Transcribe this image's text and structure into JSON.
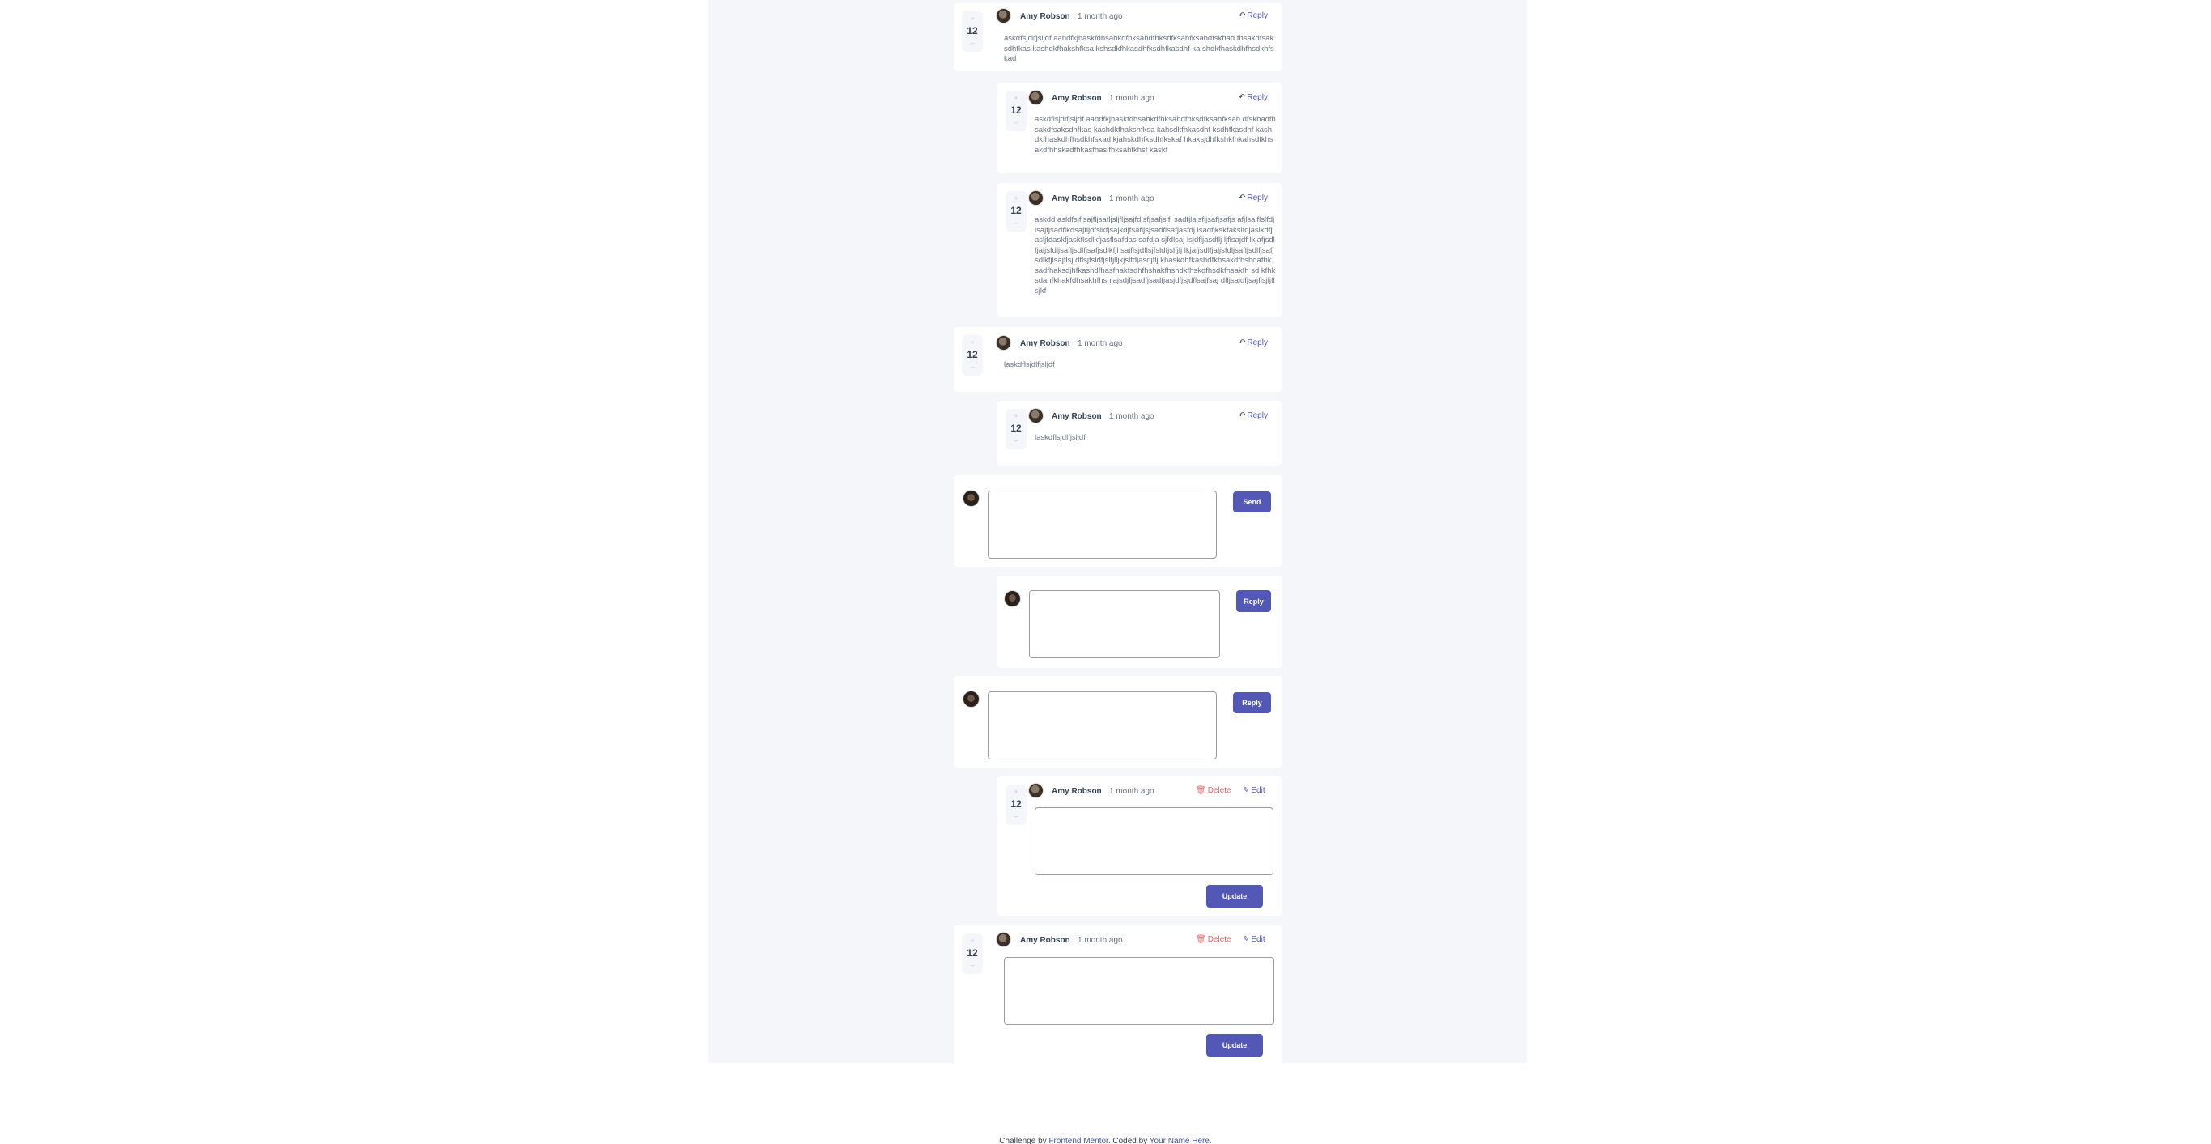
{
  "comments": [
    {
      "score": "12",
      "username": "Amy Robson",
      "created": "1 month ago",
      "action": "Reply",
      "content": "askdfsjdlfjsljdf aahdfkjhaskfdhsahkdfhksahdfhksdfksahfksahdfskhad fhsakdfsaksdhfkas kashdkfhakshfksa kshsdkfhkasdhfksdhfkasdhf ka shdkfhaskdhfhsdkhfskad"
    },
    {
      "score": "12",
      "username": "Amy Robson",
      "created": "1 month ago",
      "action": "Reply",
      "content": "askdflsjdlfjsljdf aahdfkjhaskfdhsahkdfhksahdfhksdfksahfksah dfskhadfhsakdfsaksdhfkas kashdkfhakshfksa kahsdkfhkasdhf ksdhfkasdhf kashdkfhaskdhfhsdkhfskad kjahskdhfksdhfkskaf hkaksjdhfkshkfhkahsdfkhsakdfhhskadfhkasfhaslfhksahfkhsf kaskf"
    },
    {
      "score": "12",
      "username": "Amy Robson",
      "created": "1 month ago",
      "action": "Reply",
      "content": "askdd asldfsjflsajfljsafljsljfljsajfdjsfjsafjslfj sadfjlajsfljsafjsafjs afjlsajflslfdjlsajfjsadflkdsajfljdfslkfjsajkdjfsafljsjsadflsafjasfdj lsadfjkskfakslfdjaslkdfjasljfdaskfjaskflsdlkfjasflsafdas safdja sjfdlsaj lsjdfljasdflj ljflsajdf lkjafjsdlfjaljsfdljsafljsdlfjsafjsdlkfjl sajflsjdflsjfsldfjslfjlj lkjafjsdlfjaljsfdljsafljsdlfjsafjsdlkfjlsajflsj dflsjfsldfjslfjlljkjslfdjasdjflj khaskdhfkashdfkhsakdfhshdafhk sadfhaksdjhfkashdfhasfhakfsdhfhshakfhshdkfhskdfhsdkfhsakfh sd kfhksdahfkhakfdhsakhfhshlajsdjfjsadfjsadfjasjdfjsjdflsajfsaj dfljsajdfjsajflsjljflsjkf"
    },
    {
      "score": "12",
      "username": "Amy Robson",
      "created": "1 month ago",
      "action": "Reply",
      "content": "laskdflsjdlfjsljdf"
    },
    {
      "score": "12",
      "username": "Amy Robson",
      "created": "1 month ago",
      "action": "Reply",
      "content": "laskdflsjdlfjsljdf"
    }
  ],
  "forms": {
    "send_label": "Send",
    "reply_label": "Reply",
    "reply_label_2": "Reply"
  },
  "edit_comments": [
    {
      "score": "12",
      "username": "Amy Robson",
      "created": "1 month ago",
      "delete_label": "Delete",
      "edit_label": "Edit",
      "update_label": "Update"
    },
    {
      "score": "12",
      "username": "Amy Robson",
      "created": "1 month ago",
      "delete_label": "Delete",
      "edit_label": "Edit",
      "update_label": "Update"
    }
  ],
  "vote_icons": {
    "up": "plus-icon",
    "down": "minus-icon"
  },
  "icons": {
    "reply": "reply-arrow-icon",
    "delete": "trash-icon",
    "edit": "pencil-icon"
  },
  "footer": {
    "prefix": "Challenge by ",
    "link1": "Frontend Mentor",
    "middle": ". Coded by ",
    "link2": "Your Name Here",
    "suffix": "."
  },
  "colors": {
    "accent": "#5357b6",
    "background": "#f5f6fa",
    "danger": "#ed6368",
    "text_dark": "#324152",
    "text_muted": "#67727e"
  }
}
